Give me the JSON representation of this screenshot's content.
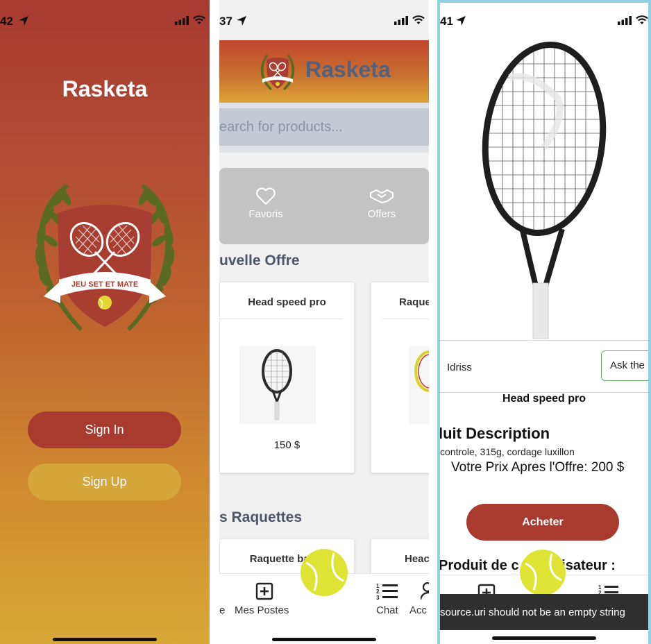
{
  "screens": {
    "welcome": {
      "status_time": "42",
      "app_title": "Rasketa",
      "crest_banner": "JEU SET ET MATE",
      "sign_in": "Sign In",
      "sign_up": "Sign Up"
    },
    "home": {
      "status_time": "37",
      "app_title": "Rasketa",
      "search_placeholder": "earch for products...",
      "quick_actions": [
        {
          "label": "Favoris",
          "icon": "heart-icon"
        },
        {
          "label": "Offers",
          "icon": "handshake-icon"
        }
      ],
      "section_new": "uvelle Offre",
      "section_racquets": "s Raquettes",
      "new_offer_cards": [
        {
          "title": "Head speed pro",
          "price": "150 $"
        },
        {
          "title": "Raque",
          "price": ""
        }
      ],
      "racquet_cards": [
        {
          "title": "Raquette balba"
        },
        {
          "title": "Heac"
        }
      ],
      "tabs": [
        {
          "label": "e",
          "icon": "home-icon"
        },
        {
          "label": "Mes Postes",
          "icon": "plus-square-icon"
        },
        {
          "label": "Chat",
          "icon": "list-numbered-icon"
        },
        {
          "label": "Acc",
          "icon": "user-icon"
        }
      ]
    },
    "product": {
      "status_time": "41",
      "seller_name": "Idriss",
      "ask_button": "Ask the",
      "product_name": "Head speed pro",
      "description_title": "luit Description",
      "description_text": "controle, 315g, cordage luxillon",
      "offer_price": "Votre Prix Apres l'Offre: 200 $",
      "buy_button": "Acheter",
      "other_products_title": "Produit de c",
      "other_products_title_tail": "lisateur :",
      "toast": "source.uri should not be an empty string"
    }
  },
  "colors": {
    "brand_red": "#a93a30",
    "brand_gold": "#d6a53b",
    "title_slate": "#55607a",
    "tennis_ball": "#dfe333"
  }
}
